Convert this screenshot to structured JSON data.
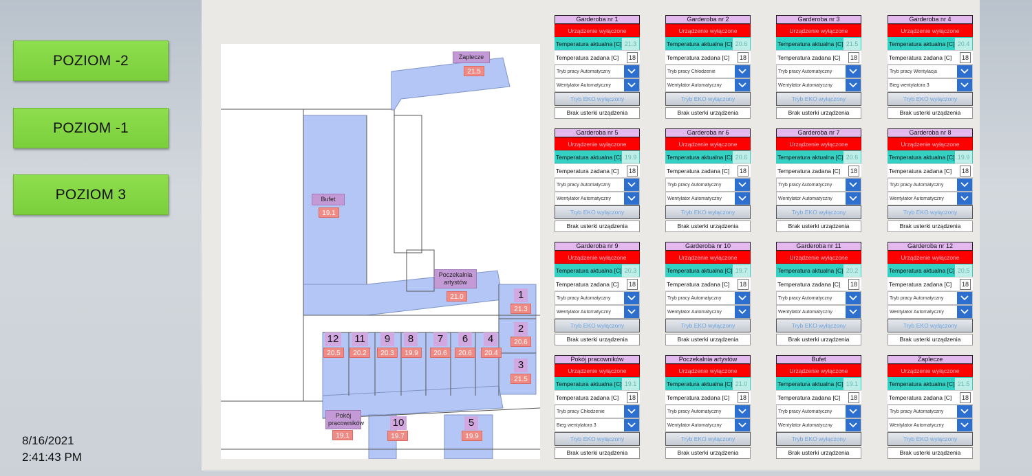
{
  "nav": {
    "buttons": [
      {
        "label": "POZIOM -2"
      },
      {
        "label": "POZIOM -1"
      },
      {
        "label": "POZIOM 3"
      }
    ]
  },
  "datetime": {
    "date": "8/16/2021",
    "time": "2:41:43 PM"
  },
  "map": {
    "rooms": [
      {
        "label": "Zaplecze",
        "temp": "21.5"
      },
      {
        "label": "Bufet",
        "temp": "19.1"
      },
      {
        "label": "Poczekalnia artystów",
        "temp": "21.0"
      },
      {
        "label": "Pokój pracowników",
        "temp": "19.1"
      }
    ],
    "dressing_rooms": [
      {
        "num": "1",
        "temp": "21.3"
      },
      {
        "num": "2",
        "temp": "20.6"
      },
      {
        "num": "3",
        "temp": "21.5"
      },
      {
        "num": "4",
        "temp": "20.4"
      },
      {
        "num": "5",
        "temp": "19.9"
      },
      {
        "num": "6",
        "temp": "20.6"
      },
      {
        "num": "7",
        "temp": "20.6"
      },
      {
        "num": "8",
        "temp": "19.9"
      },
      {
        "num": "9",
        "temp": "20.3"
      },
      {
        "num": "10",
        "temp": "19.7"
      },
      {
        "num": "11",
        "temp": "20.2"
      },
      {
        "num": "12",
        "temp": "20.5"
      }
    ]
  },
  "labels": {
    "status": "Urządzenie wyłączone",
    "temp_current": "Temperatura aktualna [C]",
    "temp_set": "Temperatura zadana [C]",
    "eco": "Tryb EKO wyłączony",
    "fault": "Brak usterki urządzenia"
  },
  "cards": [
    {
      "title": "Garderoba nr 1",
      "akt": "21.3",
      "zad": "18",
      "mode": "Tryb pracy Automatyczny",
      "fan": "Wentylator Automatyczny"
    },
    {
      "title": "Garderoba nr 2",
      "akt": "20.6",
      "zad": "18",
      "mode": "Tryb pracy Chłodzenie",
      "fan": "Wentylator Automatyczny"
    },
    {
      "title": "Garderoba nr 3",
      "akt": "21.5",
      "zad": "18",
      "mode": "Tryb pracy Automatyczny",
      "fan": "Wentylator Automatyczny"
    },
    {
      "title": "Garderoba nr 4",
      "akt": "20.4",
      "zad": "18",
      "mode": "Tryb pracy Wentylacja",
      "fan": "Bieg wentylatora 3"
    },
    {
      "title": "Garderoba nr 5",
      "akt": "19.9",
      "zad": "18",
      "mode": "Tryb pracy Automatyczny",
      "fan": "Wentylator Automatyczny"
    },
    {
      "title": "Garderoba nr 6",
      "akt": "20.6",
      "zad": "18",
      "mode": "Tryb pracy Automatyczny",
      "fan": "Wentylator Automatyczny"
    },
    {
      "title": "Garderoba nr 7",
      "akt": "20.6",
      "zad": "18",
      "mode": "Tryb pracy Automatyczny",
      "fan": "Wentylator Automatyczny"
    },
    {
      "title": "Garderoba nr 8",
      "akt": "19.9",
      "zad": "18",
      "mode": "Tryb pracy Automatyczny",
      "fan": "Wentylator Automatyczny"
    },
    {
      "title": "Garderoba nr 9",
      "akt": "20.3",
      "zad": "18",
      "mode": "Tryb pracy Automatyczny",
      "fan": "Wentylator Automatyczny"
    },
    {
      "title": "Garderoba nr 10",
      "akt": "19.7",
      "zad": "18",
      "mode": "Tryb pracy Automatyczny",
      "fan": "Wentylator Automatyczny"
    },
    {
      "title": "Garderoba nr 11",
      "akt": "20.2",
      "zad": "18",
      "mode": "Tryb pracy Automatyczny",
      "fan": "Wentylator Automatyczny"
    },
    {
      "title": "Garderoba nr 12",
      "akt": "20.5",
      "zad": "18",
      "mode": "Tryb pracy Automatyczny",
      "fan": "Wentylator Automatyczny"
    },
    {
      "title": "Pokój pracowników",
      "akt": "19.1",
      "zad": "18",
      "mode": "Tryb pracy Chłodzenie",
      "fan": "Bieg wentylatora 3"
    },
    {
      "title": "Poczekalnia artystów",
      "akt": "21.0",
      "zad": "18",
      "mode": "Tryb pracy Automatyczny",
      "fan": "Wentylator Automatyczny"
    },
    {
      "title": "Bufet",
      "akt": "19.1",
      "zad": "18",
      "mode": "Tryb pracy Automatyczny",
      "fan": "Wentylator Automatyczny"
    },
    {
      "title": "Zaplecze",
      "akt": "21.5",
      "zad": "18",
      "mode": "Tryb pracy Automatyczny",
      "fan": "Wentylator Automatyczny"
    }
  ]
}
